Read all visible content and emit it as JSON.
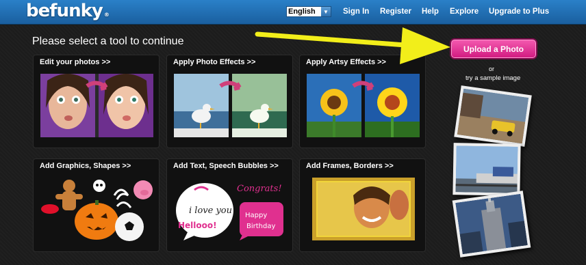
{
  "header": {
    "logo_text": "befunky",
    "logo_mark": "®",
    "language": {
      "selected": "English"
    },
    "nav": [
      "Sign In",
      "Register",
      "Help",
      "Explore",
      "Upgrade to Plus"
    ]
  },
  "main": {
    "heading": "Please select a tool to continue",
    "tiles": [
      {
        "label": "Edit your photos >>"
      },
      {
        "label": "Apply Photo Effects >>"
      },
      {
        "label": "Apply Artsy Effects >>"
      },
      {
        "label": "Add Graphics, Shapes >>"
      },
      {
        "label": "Add Text, Speech Bubbles >>",
        "texts": {
          "love": "i love you",
          "congrats": "Congrats!",
          "hello": "Hellooo!",
          "happy": "Happy",
          "birthday": "Birthday"
        }
      },
      {
        "label": "Add Frames, Borders >>"
      }
    ]
  },
  "upload": {
    "button_label": "Upload a Photo",
    "or": "or",
    "sample_text": "try a sample image"
  },
  "colors": {
    "topbar": "#2272b8",
    "upload_button": "#e0308f",
    "arrow": "#f2ee1a"
  }
}
